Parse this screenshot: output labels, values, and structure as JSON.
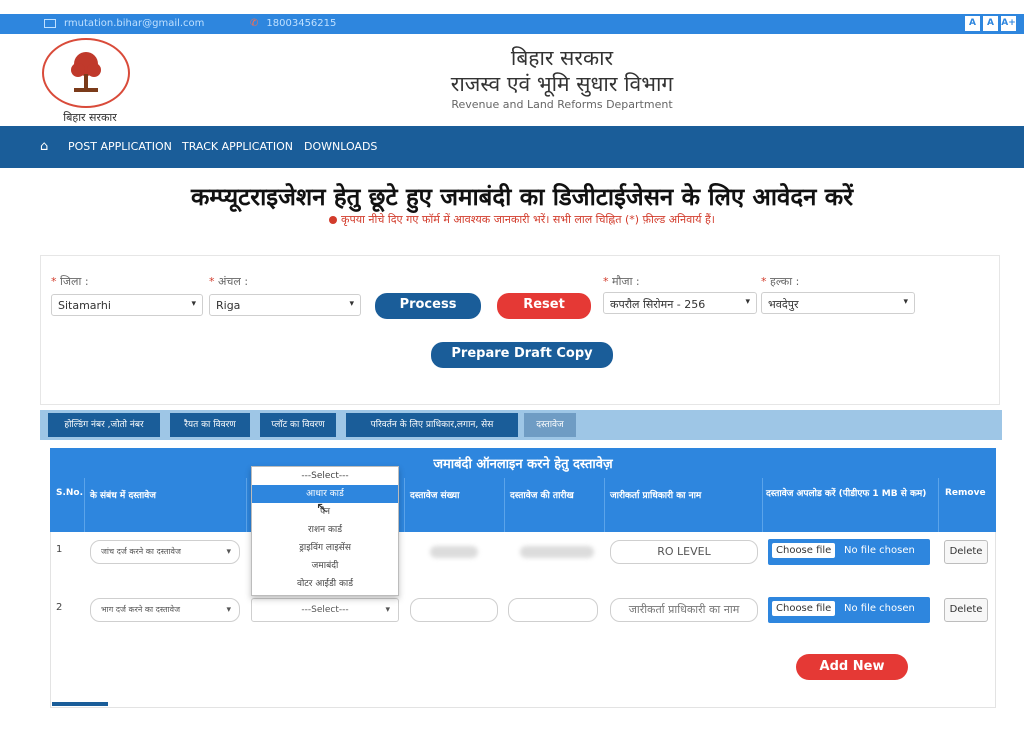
{
  "topbar": {
    "email": "rmutation.bihar@gmail.com",
    "phone": "18003456215",
    "font_sizes": [
      "A",
      "A",
      "A+"
    ]
  },
  "header": {
    "logo_text": "बिहार सरकार",
    "title_line1": "बिहार सरकार",
    "title_line2": "राजस्व एवं भूमि सुधार विभाग",
    "title_line3": "Revenue and Land Reforms Department"
  },
  "nav": {
    "items": [
      "POST APPLICATION",
      "TRACK APPLICATION",
      "DOWNLOADS"
    ]
  },
  "main": {
    "title": "कम्प्यूटराइजेशन हेतु छूटे हुए जमाबंदी का डिजीटाईजेसन के लिए आवेदन करें",
    "note": "कृपया नीचे दिए गए फॉर्म में आवश्यक जानकारी भरें। सभी लाल चिह्नित (*) फ़ील्ड अनिवार्य हैं।"
  },
  "form": {
    "district_label": "जिला :",
    "district_value": "Sitamarhi",
    "circle_label": "अंचल :",
    "circle_value": "Riga",
    "mouza_label": "मौजा :",
    "mouza_value": "कपरौल सिरोमन - 256",
    "halka_label": "हल्का :",
    "halka_value": "भवदेपुर",
    "process_btn": "Process",
    "reset_btn": "Reset",
    "draft_btn": "Prepare Draft Copy"
  },
  "tabs": [
    "होल्डिंग नंबर ,जोतो नंबर",
    "रैयत का विवरण",
    "प्लॉट का विवरण",
    "परिवर्तन के लिए प्राधिकार,लगान, सेस",
    "दस्तावेज"
  ],
  "table": {
    "title": "जमाबंदी ऑनलाइन करने हेतु दस्तावेज़",
    "headers": {
      "sno": "S.No.",
      "doc_type": "के संबंध में दस्तावेज",
      "doc_number": "दस्तावेज संख्या",
      "doc_date": "दस्तावेज की तारीख",
      "officer": "जारीकर्ता प्राधिकारी का नाम",
      "upload": "दस्तावेज अपलोड करें (पीडीएफ 1 MB से कम)",
      "remove": "Remove"
    },
    "rows": [
      {
        "sno": "1",
        "doc_type": "जांच दर्ज करने का दस्तावेज",
        "officer": "RO LEVEL",
        "file_btn": "Choose file",
        "file_status": "No file chosen",
        "delete": "Delete"
      },
      {
        "sno": "2",
        "doc_type": "भाग दर्ज करने का दस्तावेज",
        "doc_select": "---Select---",
        "officer_placeholder": "जारीकर्ता प्राधिकारी का नाम",
        "file_btn": "Choose file",
        "file_status": "No file chosen",
        "delete": "Delete"
      }
    ],
    "add_new": "Add New"
  },
  "dropdown": {
    "options": [
      "---Select---",
      "आधार कार्ड",
      "पैन",
      "राशन कार्ड",
      "ड्राइविंग लाइसेंस",
      "जमाबंदी",
      "वोटर आईडी कार्ड"
    ],
    "highlighted_index": 1
  },
  "colors": {
    "topbar": "#2e86de",
    "nav": "#1a5d99",
    "accent_red": "#e53935",
    "table_header": "#2e86de"
  }
}
